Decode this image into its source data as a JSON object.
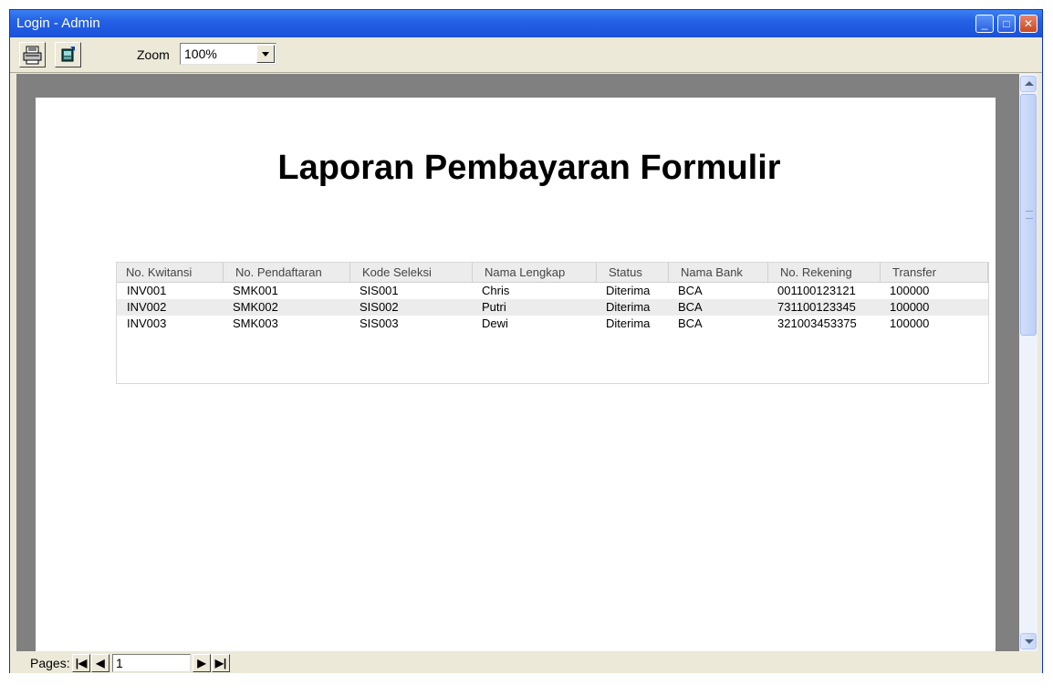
{
  "window": {
    "title": "Login - Admin",
    "minimize": "_",
    "maximize": "□",
    "close": "✕"
  },
  "toolbar": {
    "zoom_label": "Zoom",
    "zoom_value": "100%",
    "print_icon": "printer-icon",
    "export_icon": "export-icon"
  },
  "report": {
    "title": "Laporan Pembayaran Formulir",
    "columns": [
      "No. Kwitansi",
      "No. Pendaftaran",
      "Kode Seleksi",
      "Nama Lengkap",
      "Status",
      "Nama Bank",
      "No. Rekening",
      "Transfer"
    ],
    "rows": [
      [
        "INV001",
        "SMK001",
        "SIS001",
        "Chris",
        "Diterima",
        "BCA",
        "001100123121",
        "100000"
      ],
      [
        "INV002",
        "SMK002",
        "SIS002",
        "Putri",
        "Diterima",
        "BCA",
        "731100123345",
        "100000"
      ],
      [
        "INV003",
        "SMK003",
        "SIS003",
        "Dewi",
        "Diterima",
        "BCA",
        "321003453375",
        "100000"
      ]
    ]
  },
  "footer": {
    "pages_label": "Pages:",
    "page_value": "1",
    "first": "|◀",
    "prev": "◀",
    "next": "▶",
    "last": "▶|"
  },
  "colors": {
    "titlebar": "#2461e6",
    "frame": "#ece9d8",
    "viewer_bg": "#808080",
    "close_button": "#c94820"
  }
}
